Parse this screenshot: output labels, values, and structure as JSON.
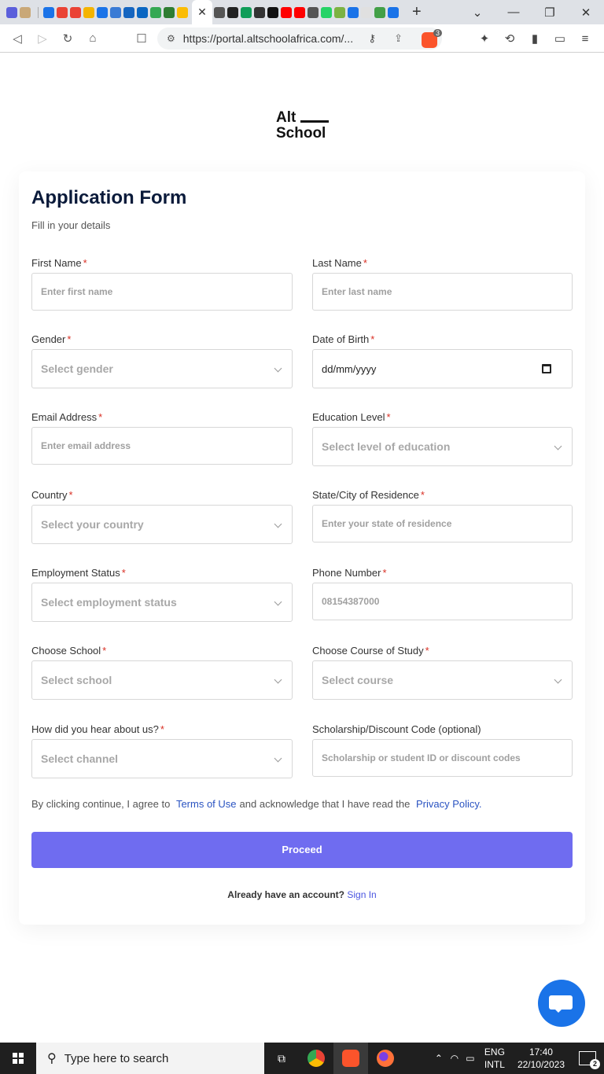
{
  "browser": {
    "url": "https://portal.altschoolafrica.com/...",
    "extension_badge": "3",
    "tab_close": "✕",
    "new_tab": "+",
    "window_controls": [
      "⌄",
      "—",
      "❐",
      "✕"
    ],
    "tab_icon_colors": [
      "#5b5fdb",
      "#c9a878",
      "#1a73e8",
      "#ea4335",
      "#ea4335",
      "#f4b400",
      "#1a73e8",
      "#3a7bd5",
      "#1565c0",
      "#0a66c2",
      "#34a853",
      "#2e7d32",
      "#fbbc04"
    ],
    "pinned_icon_colors": [
      "#555",
      "#222",
      "#0f9d58",
      "#333",
      "#111",
      "#ff0000",
      "#ff0000",
      "#555",
      "#25d366",
      "#7cb342",
      "#1a73e8",
      "#e0e0e0",
      "#43a047",
      "#1a73e8"
    ]
  },
  "page": {
    "logo_line1": "Alt",
    "logo_line2": "School",
    "title": "Application Form",
    "subtitle": "Fill in your details"
  },
  "form": {
    "first_name": {
      "label": "First Name",
      "placeholder": "Enter first name"
    },
    "last_name": {
      "label": "Last Name",
      "placeholder": "Enter last name"
    },
    "gender": {
      "label": "Gender",
      "value": "Select gender"
    },
    "dob": {
      "label": "Date of Birth",
      "value": "dd/mm/yyyy"
    },
    "email": {
      "label": "Email Address",
      "placeholder": "Enter email address"
    },
    "education": {
      "label": "Education Level",
      "value": "Select level of education"
    },
    "country": {
      "label": "Country",
      "value": "Select your country"
    },
    "state": {
      "label": "State/City of Residence",
      "placeholder": "Enter your state of residence"
    },
    "employment": {
      "label": "Employment Status",
      "value": "Select employment status"
    },
    "phone": {
      "label": "Phone Number",
      "placeholder": "08154387000"
    },
    "school": {
      "label": "Choose School",
      "value": "Select school"
    },
    "course": {
      "label": "Choose Course of Study",
      "value": "Select course"
    },
    "channel": {
      "label": "How did you hear about us?",
      "value": "Select channel"
    },
    "discount": {
      "label": "Scholarship/Discount Code (optional)",
      "placeholder": "Scholarship or student ID or discount codes"
    },
    "required_mark": "*"
  },
  "agreement": {
    "prefix": "By clicking continue, I agree to",
    "terms_link": "Terms of Use",
    "middle": "and acknowledge that I have read the",
    "privacy_link": "Privacy Policy."
  },
  "proceed_label": "Proceed",
  "signin": {
    "prompt": "Already have an account?",
    "link": "Sign In"
  },
  "taskbar": {
    "search_placeholder": "Type here to search",
    "lang_line1": "ENG",
    "lang_line2": "INTL",
    "time": "17:40",
    "date": "22/10/2023",
    "notifications": "2"
  }
}
